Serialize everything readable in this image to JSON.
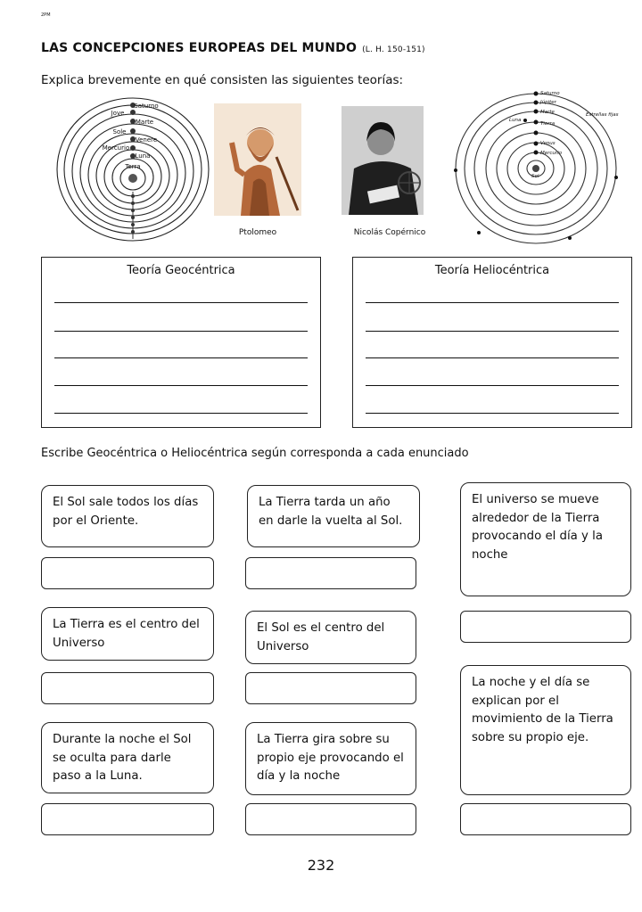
{
  "header": {
    "tag": "2PM",
    "title": "LAS CONCEPCIONES EUROPEAS DEL MUNDO",
    "reference": "(L. H. 150-151)"
  },
  "instruction1": "Explica brevemente en qué consisten las siguientes teorías:",
  "images": {
    "ptolemy_caption": "Ptolomeo",
    "copernicus_caption": "Nicolás Copérnico",
    "geo_diagram_labels": [
      "Saturno",
      "Jove",
      "Marte",
      "Sole",
      "Venere",
      "Mercurio",
      "Luna",
      "Terra"
    ],
    "helio_diagram_labels": [
      "Saturno",
      "Júpiter",
      "Marte",
      "Luna",
      "Tierra",
      "Venus",
      "Mercurio",
      "Sol",
      "Estrellas fijas"
    ]
  },
  "theory_boxes": [
    {
      "title": "Teoría Geocéntrica"
    },
    {
      "title": "Teoría Heliocéntrica"
    }
  ],
  "instruction2": "Escribe Geocéntrica o  Heliocéntrica según corresponda a cada enunciado",
  "statements": [
    "El Sol sale todos los días por el Oriente.",
    "La Tierra tarda un año en darle la vuelta al Sol.",
    "El universo se mueve alrededor de la Tierra provocando el día y la noche",
    "La Tierra es el centro del Universo",
    "El Sol es el centro del Universo",
    "La noche y el día se explican por el movimiento de la Tierra sobre su propio eje.",
    "Durante la noche el Sol se oculta para darle paso a la Luna.",
    "La Tierra gira sobre su propio eje provocando el día y la noche"
  ],
  "page_number": "232"
}
